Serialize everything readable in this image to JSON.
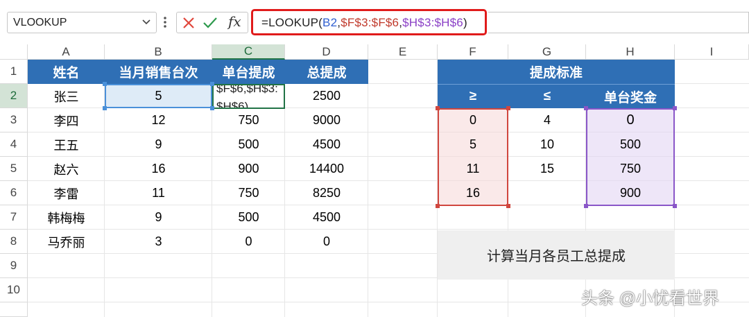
{
  "name_box": {
    "value": "VLOOKUP"
  },
  "formula_bar": {
    "fx_label": "fx",
    "formula_parts": {
      "prefix": "=LOOKUP(",
      "ref_b": "B2",
      "sep1": ",",
      "ref_f": "$F$3:$F$6",
      "sep2": ",",
      "ref_h": "$H$3:$H$6",
      "suffix": ")"
    }
  },
  "columns": [
    "A",
    "B",
    "C",
    "D",
    "E",
    "F",
    "G",
    "H",
    "I"
  ],
  "rows": [
    "1",
    "2",
    "3",
    "4",
    "5",
    "6",
    "7",
    "8",
    "9",
    "10"
  ],
  "left_table": {
    "headers": [
      "姓名",
      "当月销售台次",
      "单台提成",
      "总提成"
    ],
    "rows": [
      {
        "name": "张三",
        "units": "5",
        "unit_commission_editing": "$F$6,$H$3:\n$H$6)",
        "total": "2500"
      },
      {
        "name": "李四",
        "units": "12",
        "unit_commission": "750",
        "total": "9000"
      },
      {
        "name": "王五",
        "units": "9",
        "unit_commission": "500",
        "total": "4500"
      },
      {
        "name": "赵六",
        "units": "16",
        "unit_commission": "900",
        "total": "14400"
      },
      {
        "name": "李雷",
        "units": "11",
        "unit_commission": "750",
        "total": "8250"
      },
      {
        "name": "韩梅梅",
        "units": "9",
        "unit_commission": "500",
        "total": "4500"
      },
      {
        "name": "马乔丽",
        "units": "3",
        "unit_commission": "0",
        "total": "0"
      }
    ]
  },
  "right_table": {
    "title": "提成标准",
    "headers": [
      "≥",
      "≤",
      "单台奖金"
    ],
    "rows": [
      {
        "ge": "0",
        "le": "4",
        "bonus": "0"
      },
      {
        "ge": "5",
        "le": "10",
        "bonus": "500"
      },
      {
        "ge": "11",
        "le": "15",
        "bonus": "750"
      },
      {
        "ge": "16",
        "le": "",
        "bonus": "900"
      }
    ]
  },
  "note_box": {
    "text": "计算当月各员工总提成"
  },
  "watermark": {
    "text": "头条 @小忧看世界"
  },
  "colors": {
    "header_blue": "#2f6fb5",
    "accent_green": "#217346",
    "ref_red": "#d0463e",
    "ref_purple": "#8a56c8",
    "ref_blue": "#2f5fd0",
    "formula_border": "#e01b1b"
  }
}
